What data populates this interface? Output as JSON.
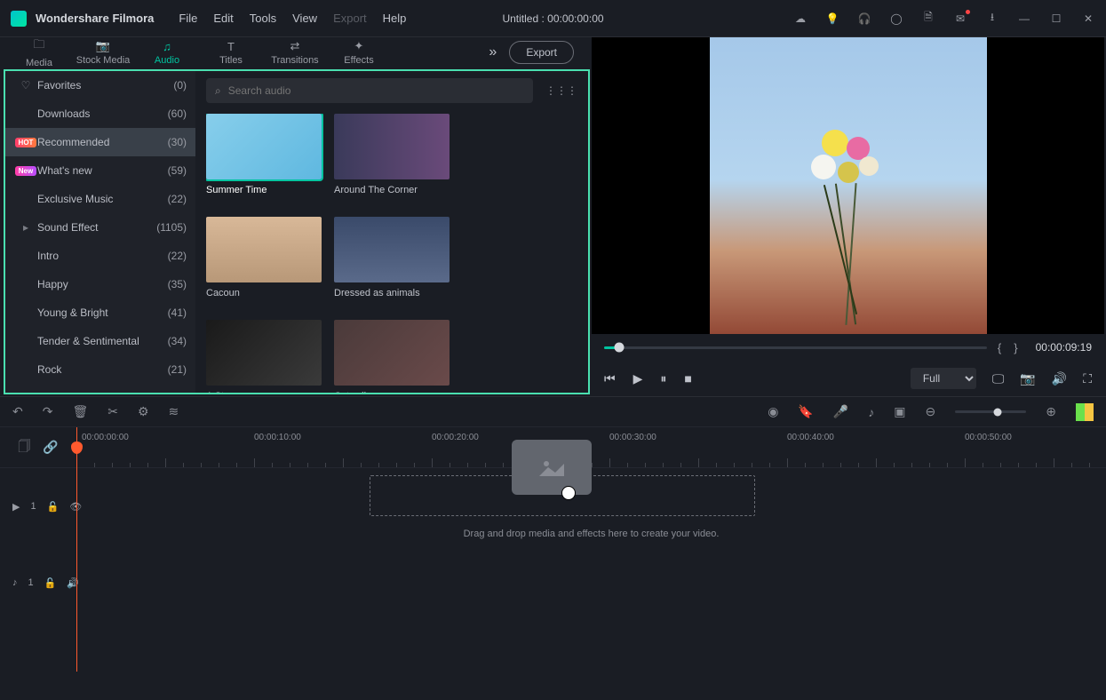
{
  "app": {
    "name": "Wondershare Filmora",
    "title": "Untitled : 00:00:00:00"
  },
  "menu": [
    "File",
    "Edit",
    "Tools",
    "View",
    "Export",
    "Help"
  ],
  "menu_disabled": "Export",
  "mode_tabs": [
    {
      "icon": "folder-icon",
      "label": "Media"
    },
    {
      "icon": "camera-icon",
      "label": "Stock Media"
    },
    {
      "icon": "music-icon",
      "label": "Audio",
      "active": true
    },
    {
      "icon": "text-icon",
      "label": "Titles"
    },
    {
      "icon": "transition-icon",
      "label": "Transitions"
    },
    {
      "icon": "sparkle-icon",
      "label": "Effects"
    }
  ],
  "export_label": "Export",
  "sidebar": [
    {
      "icon": "heart",
      "label": "Favorites",
      "count": "(0)"
    },
    {
      "icon": "",
      "label": "Downloads",
      "count": "(60)"
    },
    {
      "icon": "hot",
      "label": "Recommended",
      "count": "(30)",
      "selected": true
    },
    {
      "icon": "new",
      "label": "What's new",
      "count": "(59)"
    },
    {
      "icon": "",
      "label": "Exclusive Music",
      "count": "(22)"
    },
    {
      "icon": "caret",
      "label": "Sound Effect",
      "count": "(1105)"
    },
    {
      "icon": "",
      "label": "Intro",
      "count": "(22)"
    },
    {
      "icon": "",
      "label": "Happy",
      "count": "(35)"
    },
    {
      "icon": "",
      "label": "Young & Bright",
      "count": "(41)"
    },
    {
      "icon": "",
      "label": "Tender & Sentimental",
      "count": "(34)"
    },
    {
      "icon": "",
      "label": "Rock",
      "count": "(21)"
    }
  ],
  "search": {
    "placeholder": "Search audio"
  },
  "thumbs": [
    {
      "label": "Summer Time",
      "active": true
    },
    {
      "label": "Around The Corner"
    },
    {
      "label": "Cacoun"
    },
    {
      "label": "Dressed as animals"
    },
    {
      "label": "A Story"
    },
    {
      "label": "Catwalk queen"
    }
  ],
  "preview": {
    "quality": "Full",
    "timecode": "00:00:09:19"
  },
  "timeline": {
    "ruler_start": "00:00:00:00",
    "labels": [
      "00:00:10:00",
      "00:00:20:00",
      "00:00:30:00",
      "00:00:40:00",
      "00:00:50:00"
    ],
    "drop_text": "Drag and drop media and effects here to create your video."
  },
  "tracks": {
    "video": "1",
    "audio": "1"
  }
}
